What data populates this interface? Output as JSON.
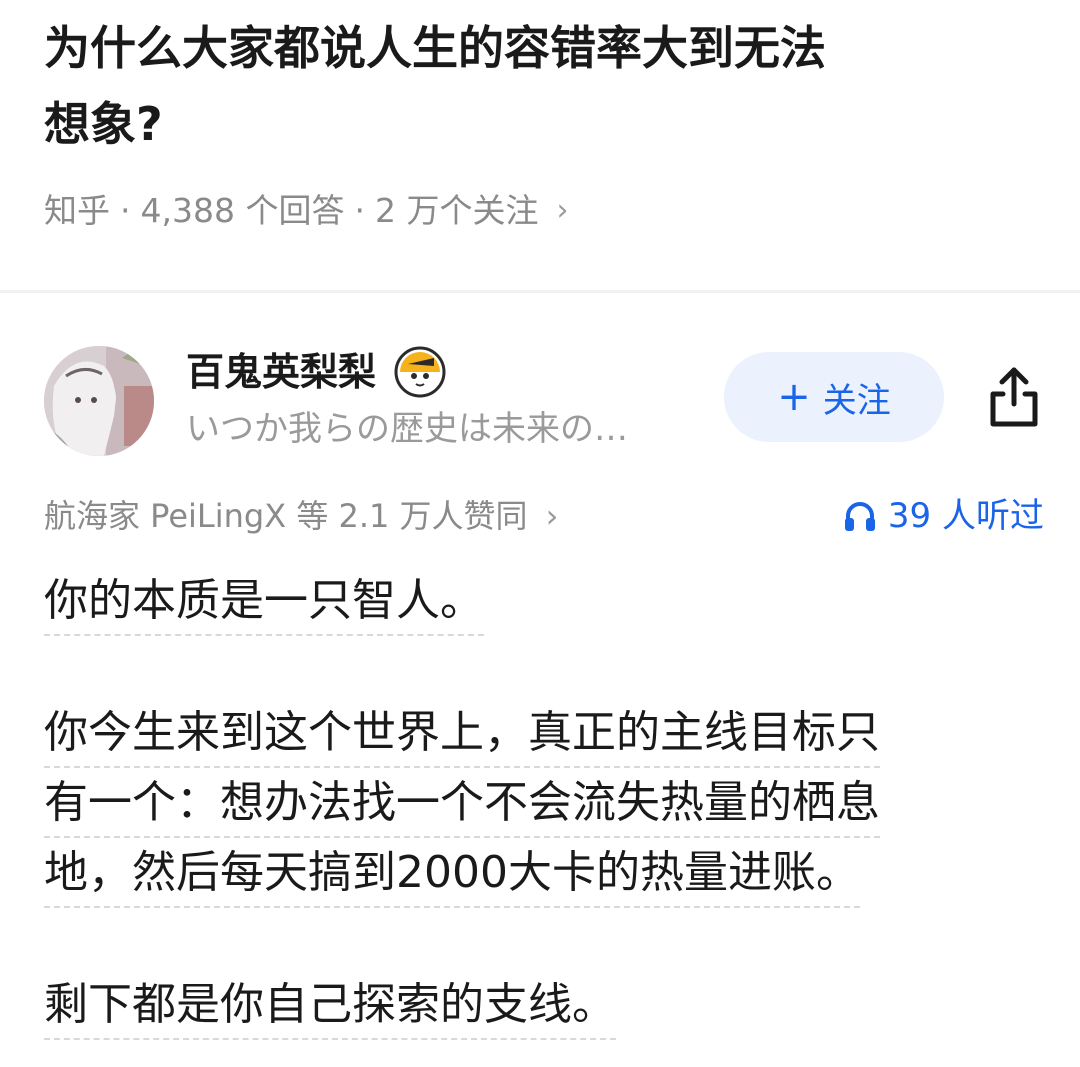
{
  "question": {
    "title_line1": "为什么大家都说人生的容错率大到无法",
    "title_line2": "想象?",
    "source": "知乎",
    "answers_count": "4,388 个回答",
    "follow_count": "2 万个关注",
    "chevron": "›"
  },
  "author": {
    "name": "百鬼英梨梨",
    "bio": "いつか我らの歴史は未来の…",
    "follow_plus": "+",
    "follow_label": "关注"
  },
  "stats": {
    "upvotes": "航海家 PeiLingX 等 2.1 万人赞同",
    "chevron": "›",
    "listens": "39 人听过"
  },
  "answer": {
    "paragraph1": [
      "你的本质是一只智人。"
    ],
    "paragraph2": [
      "你今生来到这个世界上，真正的主线目标只",
      "有一个：想办法找一个不会流失热量的栖息",
      "地，然后每天搞到2000大卡的热量进账。"
    ],
    "paragraph3": [
      "剩下都是你自己探索的支线。"
    ]
  },
  "colors": {
    "accent": "#1a64e8",
    "follow_bg": "#ebf1fd",
    "meta_gray": "#8a8a8a"
  },
  "icons": {
    "share": "share-icon",
    "headphone": "headphone-icon",
    "badge": "avatar-badge-icon"
  }
}
